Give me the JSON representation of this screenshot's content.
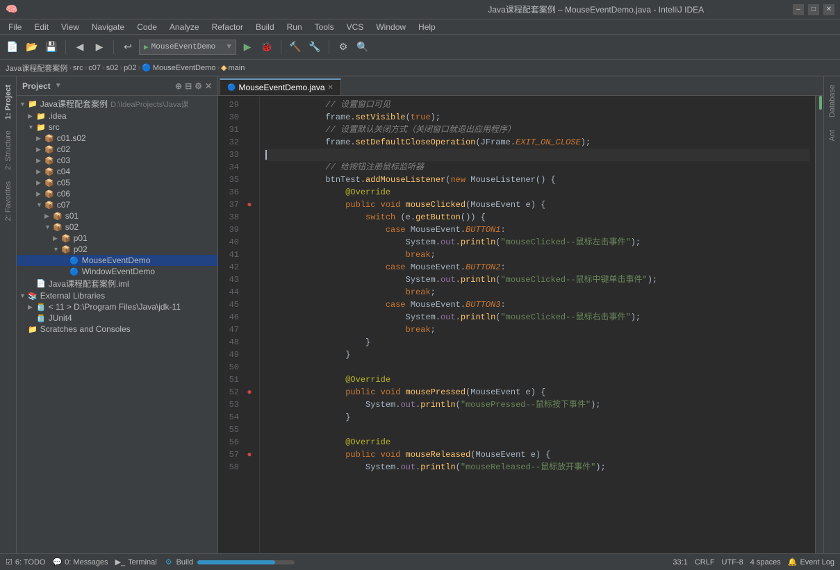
{
  "titleBar": {
    "title": "Java课程配套案例 – MouseEventDemo.java - IntelliJ IDEA",
    "minimize": "–",
    "maximize": "□",
    "close": "✕"
  },
  "menuBar": {
    "items": [
      "File",
      "Edit",
      "View",
      "Navigate",
      "Code",
      "Analyze",
      "Refactor",
      "Build",
      "Run",
      "Tools",
      "VCS",
      "Window",
      "Help"
    ]
  },
  "toolbar": {
    "dropdown": "MouseEventDemo",
    "runLabel": "▶",
    "buildLabel": "🔨"
  },
  "breadcrumb": {
    "items": [
      "Java课程配套案例",
      "src",
      "c07",
      "s02",
      "p02",
      "MouseEventDemo",
      "main"
    ]
  },
  "sidebar": {
    "title": "Project",
    "tree": [
      {
        "indent": 0,
        "arrow": "▼",
        "icon": "project",
        "label": "Java课程配套案例",
        "path": "D:\\IdeaProjects\\Java课"
      },
      {
        "indent": 1,
        "arrow": "▼",
        "icon": "folder",
        "label": ".idea"
      },
      {
        "indent": 1,
        "arrow": "▼",
        "icon": "src",
        "label": "src"
      },
      {
        "indent": 2,
        "arrow": "▶",
        "icon": "folder",
        "label": "c01.s02"
      },
      {
        "indent": 2,
        "arrow": "▶",
        "icon": "folder",
        "label": "c02"
      },
      {
        "indent": 2,
        "arrow": "▶",
        "icon": "folder",
        "label": "c03"
      },
      {
        "indent": 2,
        "arrow": "▶",
        "icon": "folder",
        "label": "c04"
      },
      {
        "indent": 2,
        "arrow": "▶",
        "icon": "folder",
        "label": "c05"
      },
      {
        "indent": 2,
        "arrow": "▶",
        "icon": "folder",
        "label": "c06"
      },
      {
        "indent": 2,
        "arrow": "▼",
        "icon": "folder",
        "label": "c07"
      },
      {
        "indent": 3,
        "arrow": "▶",
        "icon": "folder",
        "label": "s01"
      },
      {
        "indent": 3,
        "arrow": "▼",
        "icon": "folder",
        "label": "s02"
      },
      {
        "indent": 4,
        "arrow": "▶",
        "icon": "folder",
        "label": "p01"
      },
      {
        "indent": 4,
        "arrow": "▼",
        "icon": "folder",
        "label": "p02",
        "selected": true
      },
      {
        "indent": 5,
        "arrow": "",
        "icon": "java",
        "label": "MouseEventDemo"
      },
      {
        "indent": 5,
        "arrow": "",
        "icon": "java",
        "label": "WindowEventDemo"
      },
      {
        "indent": 1,
        "arrow": "",
        "icon": "iml",
        "label": "Java课程配套案例.iml"
      },
      {
        "indent": 0,
        "arrow": "▼",
        "icon": "folder",
        "label": "External Libraries"
      },
      {
        "indent": 1,
        "arrow": "▶",
        "icon": "jar",
        "label": "< 11 > D:\\Program Files\\Java\\jdk-11"
      },
      {
        "indent": 1,
        "arrow": "",
        "icon": "jar",
        "label": "JUnit4"
      },
      {
        "indent": 0,
        "arrow": "",
        "icon": "folder",
        "label": "Scratches and Consoles"
      }
    ]
  },
  "editor": {
    "filename": "MouseEventDemo.java",
    "lines": [
      {
        "num": 29,
        "gutter": "",
        "code": "            <comment>// 设置窗口可见</comment>",
        "type": "comment"
      },
      {
        "num": 30,
        "gutter": "",
        "code": "            frame.<method>setVisible</method>(<kw>true</kw>);",
        "type": "code"
      },
      {
        "num": 31,
        "gutter": "",
        "code": "            <comment>// 设置默认关闭方式（关闭窗口就退出应用程序）</comment>",
        "type": "comment"
      },
      {
        "num": 32,
        "gutter": "",
        "code": "            frame.<method>setDefaultCloseOperation</method>(JFrame.<italic>EXIT_ON_CLOSE</italic>);",
        "type": "code"
      },
      {
        "num": 33,
        "gutter": "cursor",
        "code": "",
        "type": "cursor"
      },
      {
        "num": 34,
        "gutter": "",
        "code": "            <comment>// 给按钮注册鼠标监听器</comment>",
        "type": "comment"
      },
      {
        "num": 35,
        "gutter": "",
        "code": "            btnTest.<method>addMouseListener</method>(<kw>new</kw> MouseListener() {",
        "type": "code"
      },
      {
        "num": 36,
        "gutter": "",
        "code": "                <annotation>@Override</annotation>",
        "type": "code"
      },
      {
        "num": 37,
        "gutter": "bp",
        "code": "                <kw>public</kw> <kw>void</kw> <method>mouseClicked</method>(MouseEvent e) {",
        "type": "code"
      },
      {
        "num": 38,
        "gutter": "",
        "code": "                    <kw>switch</kw> (e.<method>getButton</method>()) {",
        "type": "code"
      },
      {
        "num": 39,
        "gutter": "",
        "code": "                        <kw>case</kw> MouseEvent.<italic>BUTTON1</italic>:",
        "type": "code"
      },
      {
        "num": 40,
        "gutter": "",
        "code": "                            System.<static>out</static>.<method>println</method>(<string>\"mouseClicked--鼠标左击事件\"</string>);",
        "type": "code"
      },
      {
        "num": 41,
        "gutter": "",
        "code": "                            <kw>break</kw>;",
        "type": "code"
      },
      {
        "num": 42,
        "gutter": "",
        "code": "                        <kw>case</kw> MouseEvent.<italic>BUTTON2</italic>:",
        "type": "code"
      },
      {
        "num": 43,
        "gutter": "",
        "code": "                            System.<static>out</static>.<method>println</method>(<string>\"mouseClicked--鼠标中键单击事件\"</string>);",
        "type": "code"
      },
      {
        "num": 44,
        "gutter": "",
        "code": "                            <kw>break</kw>;",
        "type": "code"
      },
      {
        "num": 45,
        "gutter": "",
        "code": "                        <kw>case</kw> MouseEvent.<italic>BUTTON3</italic>:",
        "type": "code"
      },
      {
        "num": 46,
        "gutter": "",
        "code": "                            System.<static>out</static>.<method>println</method>(<string>\"mouseClicked--鼠标右击事件\"</string>);",
        "type": "code"
      },
      {
        "num": 47,
        "gutter": "",
        "code": "                            <kw>break</kw>;",
        "type": "code"
      },
      {
        "num": 48,
        "gutter": "",
        "code": "                    }",
        "type": "code"
      },
      {
        "num": 49,
        "gutter": "",
        "code": "                }",
        "type": "code"
      },
      {
        "num": 50,
        "gutter": "",
        "code": "",
        "type": "empty"
      },
      {
        "num": 51,
        "gutter": "",
        "code": "                <annotation>@Override</annotation>",
        "type": "code"
      },
      {
        "num": 52,
        "gutter": "bp",
        "code": "                <kw>public</kw> <kw>void</kw> <method>mousePressed</method>(MouseEvent e) {",
        "type": "code"
      },
      {
        "num": 53,
        "gutter": "",
        "code": "                    System.<static>out</static>.<method>println</method>(<string>\"mousePressed--鼠标按下事件\"</string>);",
        "type": "code"
      },
      {
        "num": 54,
        "gutter": "",
        "code": "                }",
        "type": "code"
      },
      {
        "num": 55,
        "gutter": "",
        "code": "",
        "type": "empty"
      },
      {
        "num": 56,
        "gutter": "",
        "code": "                <annotation>@Override</annotation>",
        "type": "code"
      },
      {
        "num": 57,
        "gutter": "bp",
        "code": "                <kw>public</kw> <kw>void</kw> <method>mouseReleased</method>(MouseEvent e) {",
        "type": "code"
      },
      {
        "num": 58,
        "gutter": "",
        "code": "                    System.<static>out</static>.<method>println</method>(<string>\"mouseReleased--鼠标放开事件\"</string>);",
        "type": "code"
      }
    ]
  },
  "statusBar": {
    "todo": "6: TODO",
    "messages": "0: Messages",
    "terminal": "Terminal",
    "build": "Build",
    "position": "33:1",
    "lineEnding": "CRLF",
    "encoding": "UTF-8",
    "indent": "4 spaces",
    "eventLog": "Event Log"
  },
  "rightTabs": [
    "Database",
    "Ant"
  ],
  "leftTabs": [
    "1: Project",
    "2: Structure",
    "2: Favorites"
  ]
}
